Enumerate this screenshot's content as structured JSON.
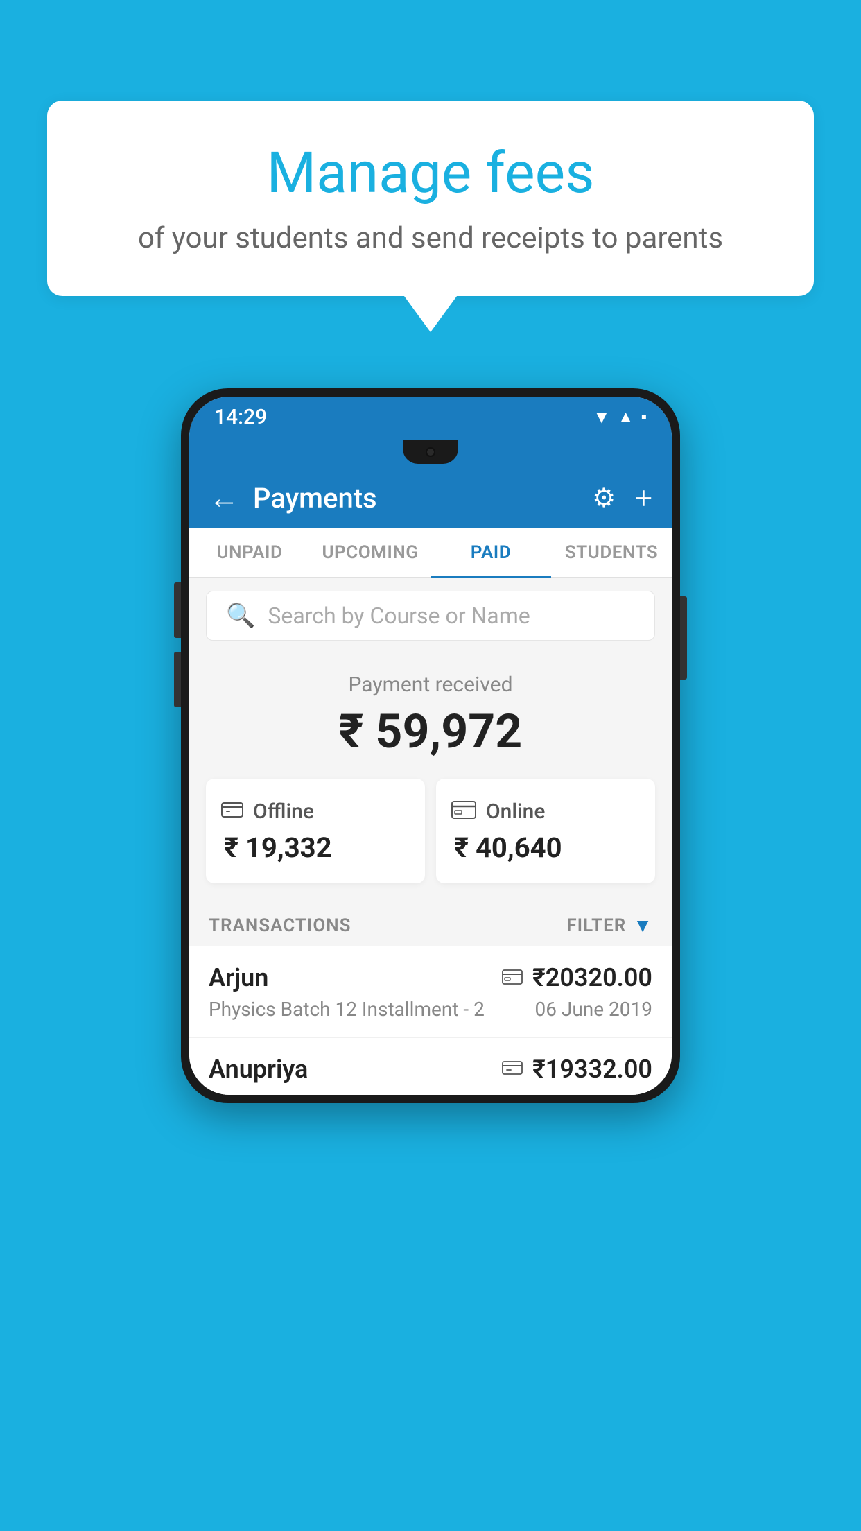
{
  "background": {
    "color": "#1ab0e0"
  },
  "speech_bubble": {
    "title": "Manage fees",
    "subtitle": "of your students and send receipts to parents"
  },
  "status_bar": {
    "time": "14:29",
    "icons": [
      "wifi",
      "signal",
      "battery"
    ]
  },
  "header": {
    "title": "Payments",
    "back_label": "←",
    "gear_label": "⚙",
    "plus_label": "+"
  },
  "tabs": [
    {
      "label": "UNPAID",
      "active": false
    },
    {
      "label": "UPCOMING",
      "active": false
    },
    {
      "label": "PAID",
      "active": true
    },
    {
      "label": "STUDENTS",
      "active": false
    }
  ],
  "search": {
    "placeholder": "Search by Course or Name"
  },
  "payment_summary": {
    "received_label": "Payment received",
    "amount": "₹ 59,972",
    "cards": [
      {
        "type": "Offline",
        "amount": "₹ 19,332",
        "icon": "offline"
      },
      {
        "type": "Online",
        "amount": "₹ 40,640",
        "icon": "online"
      }
    ]
  },
  "transactions": {
    "header_label": "TRANSACTIONS",
    "filter_label": "FILTER",
    "items": [
      {
        "name": "Arjun",
        "course": "Physics Batch 12 Installment - 2",
        "amount": "₹20320.00",
        "date": "06 June 2019",
        "payment_type": "online"
      },
      {
        "name": "Anupriya",
        "course": "",
        "amount": "₹19332.00",
        "date": "",
        "payment_type": "offline"
      }
    ]
  }
}
